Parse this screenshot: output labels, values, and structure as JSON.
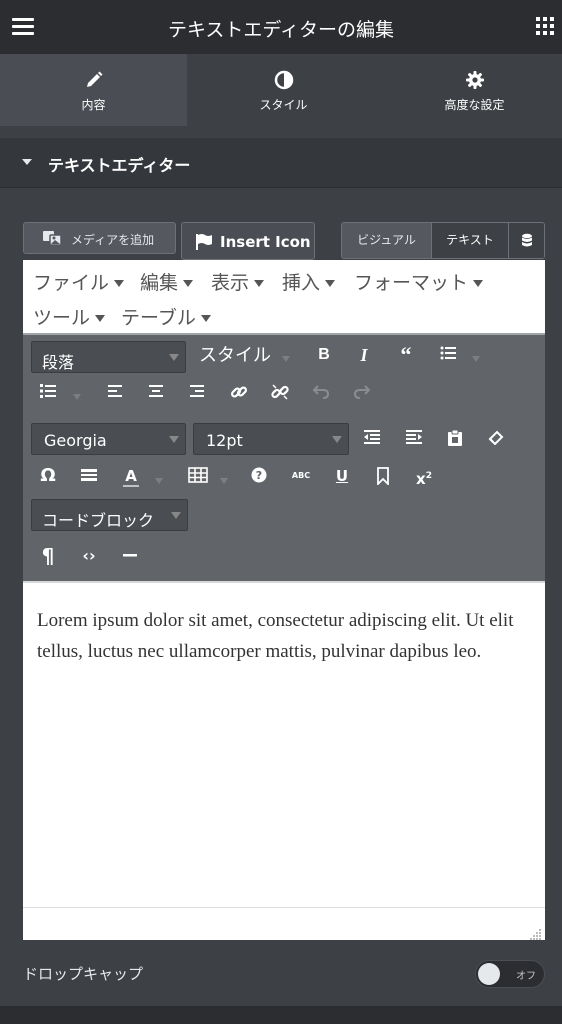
{
  "header": {
    "title": "テキストエディターの編集",
    "menu_icon": "hamburger-icon",
    "apps_icon": "grid-icon"
  },
  "tabs": [
    {
      "label": "内容",
      "icon": "pencil-icon",
      "active": true
    },
    {
      "label": "スタイル",
      "icon": "half-circle-icon",
      "active": false
    },
    {
      "label": "高度な設定",
      "icon": "gear-icon",
      "active": false
    }
  ],
  "section": {
    "title": "テキストエディター"
  },
  "media_buttons": {
    "add_media": "メディアを追加",
    "insert_icon": "Insert Icon"
  },
  "mode_tabs": {
    "visual": "ビジュアル",
    "text": "テキスト"
  },
  "menubar": [
    {
      "label": "ファイル"
    },
    {
      "label": "編集"
    },
    {
      "label": "表示"
    },
    {
      "label": "挿入"
    },
    {
      "label": "フォーマット"
    },
    {
      "label": "ツール"
    },
    {
      "label": "テーブル"
    }
  ],
  "toolbar": {
    "block_format": "段落",
    "style_format": "スタイル",
    "font_family": "Georgia",
    "font_size": "12pt",
    "code_block": "コードブロック"
  },
  "content": {
    "text": "Lorem ipsum dolor sit amet, consectetur adipiscing elit. Ut elit tellus, luctus nec ullamcorper mattis, pulvinar dapibus leo."
  },
  "dropcap": {
    "label": "ドロップキャップ",
    "toggle_text": "オフ",
    "enabled": false
  },
  "colors": {
    "accent": "#59c5e6",
    "panel": "#3d4045",
    "header": "#2b2d31",
    "toolbar": "#616468"
  }
}
